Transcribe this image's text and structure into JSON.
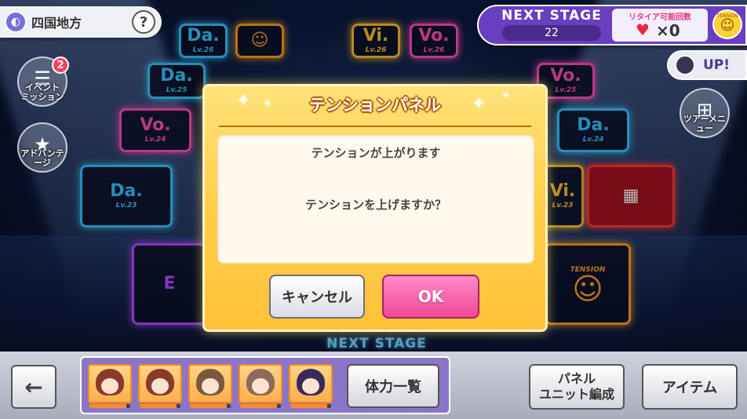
{
  "region": {
    "name": "四国地方",
    "help_label": "?"
  },
  "left_menu": {
    "event_mission": {
      "label": "イベント\nミッション",
      "badge": "2",
      "icon": "checklist-icon"
    },
    "advantage": {
      "label": "アドバンテージ",
      "icon": "star-emblem-icon"
    }
  },
  "stage_info": {
    "title": "NEXT STAGE",
    "stage_number": "22",
    "retire_label": "リタイア可能回数",
    "retire_count": "×0",
    "tension_label": "TENSION"
  },
  "up_button": {
    "label": "UP!"
  },
  "tour_menu": {
    "label": "ツアーメニュー",
    "icon": "grid-icon"
  },
  "board": {
    "tiles": [
      {
        "kind": "da",
        "main": "Da.",
        "lv": "Lv.26"
      },
      {
        "kind": "tn",
        "main": "☺",
        "lv": ""
      },
      {
        "kind": "vi",
        "main": "Vi.",
        "lv": "Lv.26"
      },
      {
        "kind": "vo",
        "main": "Vo.",
        "lv": "Lv.26"
      },
      {
        "kind": "da",
        "main": "Da.",
        "lv": "Lv.25"
      },
      {
        "kind": "vo",
        "main": "Vo.",
        "lv": "Lv.25"
      },
      {
        "kind": "vo",
        "main": "Vo.",
        "lv": "Lv.24"
      },
      {
        "kind": "da",
        "main": "Da.",
        "lv": "Lv.24"
      },
      {
        "kind": "da",
        "main": "Da.",
        "lv": "Lv.23"
      },
      {
        "kind": "vi",
        "main": "Vi.",
        "lv": "Lv.23"
      },
      {
        "kind": "gf",
        "main": "▦",
        "lv": ""
      },
      {
        "kind": "pp",
        "main": "E",
        "lv": ""
      },
      {
        "kind": "tn",
        "main": "☺",
        "lv": "TENSION"
      }
    ],
    "next_stage_floor": "NEXT STAGE"
  },
  "dialog": {
    "title": "テンションパネル",
    "message_1": "テンションが上がります",
    "message_2": "テンションを上げますか？",
    "cancel_label": "キャンセル",
    "ok_label": "OK"
  },
  "bottom_bar": {
    "back_label": "←",
    "members": [
      {
        "hair": "#8a3a2a",
        "stamina": 0.9
      },
      {
        "hair": "#8a3a2a",
        "stamina": 0.9
      },
      {
        "hair": "#7a5a3a",
        "stamina": 0.9
      },
      {
        "hair": "#8a6a5a",
        "stamina": 0.9
      },
      {
        "hair": "#3a2a5a",
        "stamina": 0.9
      }
    ],
    "stamina_list_label": "体力一覧",
    "panel_unit_label": "パネル\nユニット編成",
    "item_label": "アイテム"
  },
  "colors": {
    "dialog_gold": "#ffcf4a",
    "ok_pink": "#f04898",
    "stage_purple": "#6a3fbf"
  }
}
